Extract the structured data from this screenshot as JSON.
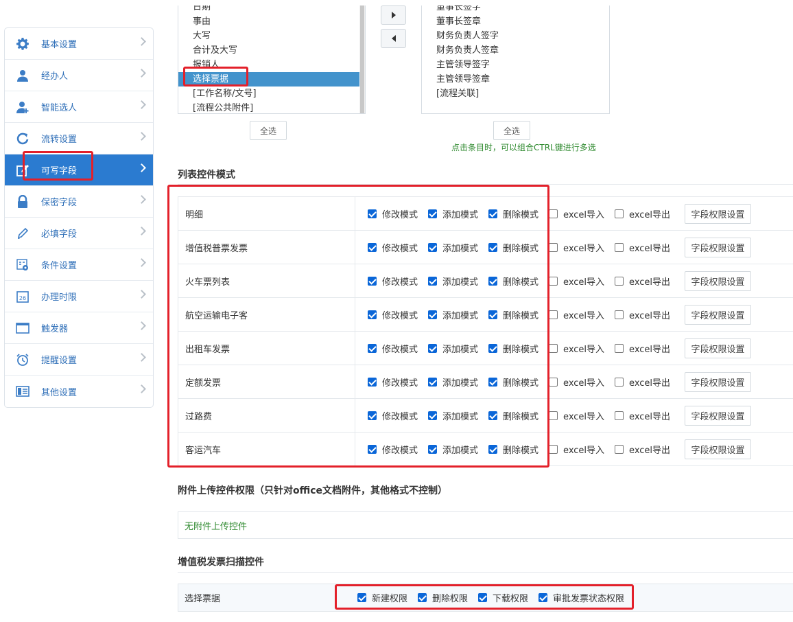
{
  "sidebar": {
    "items": [
      {
        "label": "基本设置",
        "icon": "gear-icon"
      },
      {
        "label": "经办人",
        "icon": "user-icon"
      },
      {
        "label": "智能选人",
        "icon": "user-add-icon"
      },
      {
        "label": "流转设置",
        "icon": "refresh-icon"
      },
      {
        "label": "可写字段",
        "icon": "edit-icon",
        "active": true
      },
      {
        "label": "保密字段",
        "icon": "lock-icon"
      },
      {
        "label": "必填字段",
        "icon": "pencil-icon"
      },
      {
        "label": "条件设置",
        "icon": "condition-icon"
      },
      {
        "label": "办理时限",
        "icon": "calendar-icon"
      },
      {
        "label": "触发器",
        "icon": "window-icon"
      },
      {
        "label": "提醒设置",
        "icon": "alarm-icon"
      },
      {
        "label": "其他设置",
        "icon": "list-icon"
      }
    ]
  },
  "field_picker": {
    "left_items": [
      "日期",
      "事由",
      "大写",
      "合计及大写",
      "报销人",
      "选择票据",
      "[工作名称/文号]",
      "[流程公共附件]"
    ],
    "left_selected": "选择票据",
    "right_items": [
      "董事长签字",
      "董事长签章",
      "财务负责人签字",
      "财务负责人签章",
      "主管领导签字",
      "主管领导签章",
      "[流程关联]"
    ],
    "select_all_left": "全选",
    "select_all_right": "全选",
    "hint": "点击条目时，可以组合CTRL键进行多选"
  },
  "list_control": {
    "title": "列表控件模式",
    "option_labels": {
      "modify": "修改模式",
      "add": "添加模式",
      "delete": "删除模式",
      "import": "excel导入",
      "export": "excel导出",
      "perm_button": "字段权限设置"
    },
    "rows": [
      {
        "name": "明细",
        "modify": true,
        "add": true,
        "delete": true,
        "import": false,
        "export": false
      },
      {
        "name": "增值税普票发票",
        "modify": true,
        "add": true,
        "delete": true,
        "import": false,
        "export": false
      },
      {
        "name": "火车票列表",
        "modify": true,
        "add": true,
        "delete": true,
        "import": false,
        "export": false
      },
      {
        "name": "航空运输电子客",
        "modify": true,
        "add": true,
        "delete": true,
        "import": false,
        "export": false
      },
      {
        "name": "出租车发票",
        "modify": true,
        "add": true,
        "delete": true,
        "import": false,
        "export": false
      },
      {
        "name": "定额发票",
        "modify": true,
        "add": true,
        "delete": true,
        "import": false,
        "export": false
      },
      {
        "name": "过路费",
        "modify": true,
        "add": true,
        "delete": true,
        "import": false,
        "export": false
      },
      {
        "name": "客运汽车",
        "modify": true,
        "add": true,
        "delete": true,
        "import": false,
        "export": false
      }
    ]
  },
  "upload_control": {
    "title": "附件上传控件权限（只针对office文档附件，其他格式不控制）",
    "empty_text": "无附件上传控件"
  },
  "invoice_scan": {
    "title": "增值税发票扫描控件",
    "row_name": "选择票据",
    "options": [
      {
        "label": "新建权限",
        "checked": true
      },
      {
        "label": "删除权限",
        "checked": true
      },
      {
        "label": "下载权限",
        "checked": true
      },
      {
        "label": "审批发票状态权限",
        "checked": true
      }
    ]
  },
  "colors": {
    "accent": "#2b7bd0",
    "highlight": "#e3202a",
    "hint": "#2f8a2f"
  }
}
